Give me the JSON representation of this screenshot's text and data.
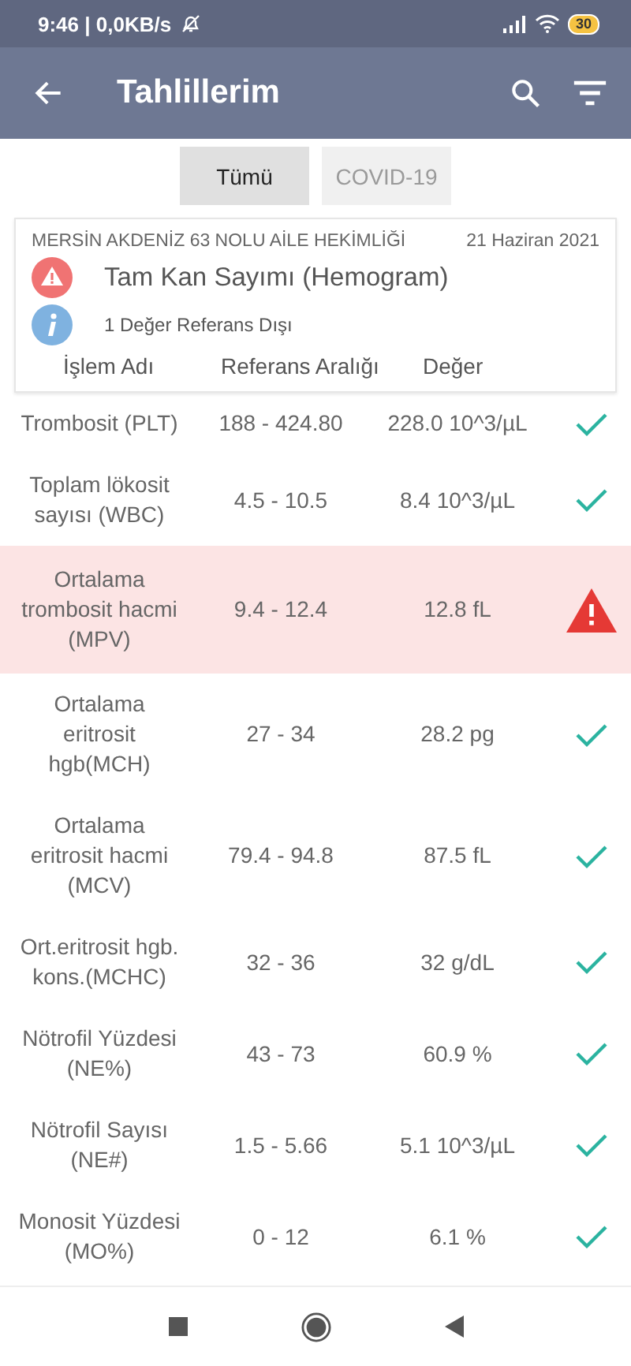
{
  "status_bar": {
    "time": "9:46 | 0,0KB/s",
    "battery": "30"
  },
  "app_bar": {
    "title": "Tahlillerim"
  },
  "tabs": [
    {
      "label": "Tümü",
      "selected": true
    },
    {
      "label": "COVID-19",
      "selected": false
    }
  ],
  "card": {
    "institution": "MERSİN AKDENİZ 63 NOLU AİLE HEKİMLİĞİ",
    "date": "21 Haziran 2021",
    "test_name": "Tam Kan Sayımı (Hemogram)",
    "note": "1 Değer Referans Dışı",
    "columns": [
      "İşlem Adı",
      "Referans Aralığı",
      "Değer"
    ]
  },
  "rows": [
    {
      "name": "Trombosit (PLT)",
      "range": "188 - 424.80",
      "value": "228.0 10^3/µL",
      "flagged": false
    },
    {
      "name": "Toplam lökosit sayısı (WBC)",
      "range": "4.5 - 10.5",
      "value": "8.4 10^3/µL",
      "flagged": false
    },
    {
      "name": "Ortalama trombosit hacmi (MPV)",
      "range": "9.4 - 12.4",
      "value": "12.8 fL",
      "flagged": true
    },
    {
      "name": "Ortalama eritrosit hgb(MCH)",
      "range": "27 - 34",
      "value": "28.2 pg",
      "flagged": false
    },
    {
      "name": "Ortalama eritrosit hacmi (MCV)",
      "range": "79.4 - 94.8",
      "value": "87.5 fL",
      "flagged": false
    },
    {
      "name": "Ort.eritrosit hgb. kons.(MCHC)",
      "range": "32 - 36",
      "value": "32 g/dL",
      "flagged": false
    },
    {
      "name": "Nötrofil Yüzdesi (NE%)",
      "range": "43 - 73",
      "value": "60.9 %",
      "flagged": false
    },
    {
      "name": "Nötrofil Sayısı (NE#)",
      "range": "1.5 - 5.66",
      "value": "5.1 10^3/µL",
      "flagged": false
    },
    {
      "name": "Monosit Yüzdesi (MO%)",
      "range": "0 - 12",
      "value": "6.1 %",
      "flagged": false
    }
  ]
}
